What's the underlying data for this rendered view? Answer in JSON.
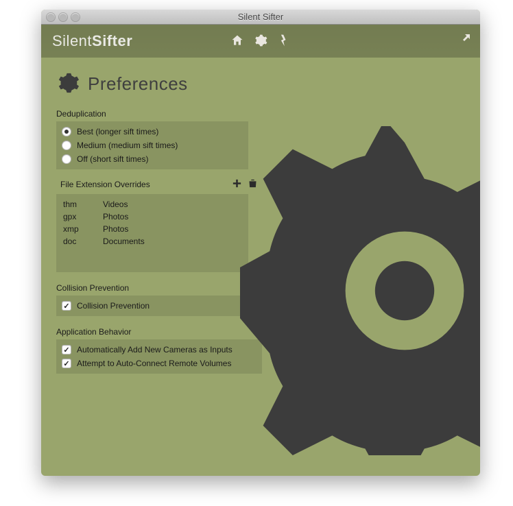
{
  "window": {
    "title": "Silent Sifter"
  },
  "brand": {
    "prefix": "Silent",
    "suffix": "Sifter"
  },
  "page": {
    "title": "Preferences"
  },
  "sections": {
    "dedup": {
      "label": "Deduplication",
      "options": [
        {
          "label": "Best (longer sift times)",
          "selected": true
        },
        {
          "label": "Medium (medium sift times)",
          "selected": false
        },
        {
          "label": "Off (short sift times)",
          "selected": false
        }
      ]
    },
    "extensions": {
      "label": "File Extension Overrides",
      "rows": [
        {
          "ext": "thm",
          "cat": "Videos"
        },
        {
          "ext": "gpx",
          "cat": "Photos"
        },
        {
          "ext": "xmp",
          "cat": "Photos"
        },
        {
          "ext": "doc",
          "cat": "Documents"
        }
      ]
    },
    "collision": {
      "label": "Collision Prevention",
      "check": {
        "label": "Collision Prevention",
        "checked": true
      }
    },
    "behavior": {
      "label": "Application Behavior",
      "checks": [
        {
          "label": "Automatically Add New Cameras as Inputs",
          "checked": true
        },
        {
          "label": "Attempt to Auto-Connect Remote Volumes",
          "checked": true
        }
      ]
    }
  }
}
